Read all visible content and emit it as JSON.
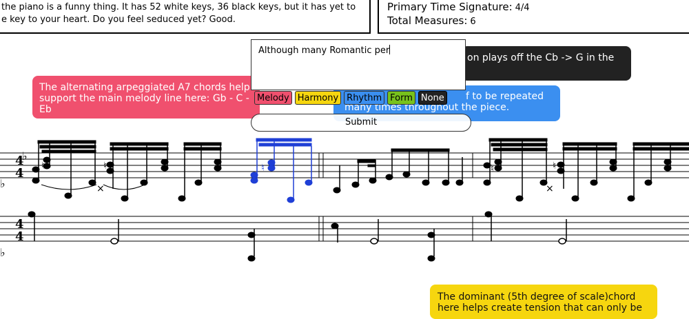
{
  "intro": {
    "line1": "the piano is a funny thing. It has 52 white keys, 36 black keys, but it has yet to",
    "line2": "e key to your heart. Do you feel seduced yet? Good."
  },
  "info": {
    "time_sig_label": "Primary Time Signature:",
    "time_sig_value": "4/4",
    "measures_label": "Total Measures:",
    "measures_value": "6"
  },
  "annotations": {
    "black": "on plays off the Cb -> G in the",
    "red_line1": "The alternating arpeggiated A7 chords help",
    "red_line2": "support the main melody line here: Gb - C -",
    "red_line3": "Eb",
    "blue_line1": "f to be repeated",
    "blue_line2": "many times throughout the piece.",
    "yellow_line1": "The dominant (5th degree of scale)chord",
    "yellow_line2": "here helps create tension that can only be"
  },
  "composer": {
    "text": "Although many Romantic per",
    "tags": [
      "Melody",
      "Harmony",
      "Rhythm",
      "Form",
      "None"
    ],
    "tag_colors": [
      "#f0506e",
      "#f6d60f",
      "#3b8ff0",
      "#78c21c",
      "#222222"
    ],
    "submit_label": "Submit"
  },
  "score": {
    "time_signature_top": "4",
    "time_signature_bottom": "4",
    "highlight_color": "#1f3fd6"
  }
}
